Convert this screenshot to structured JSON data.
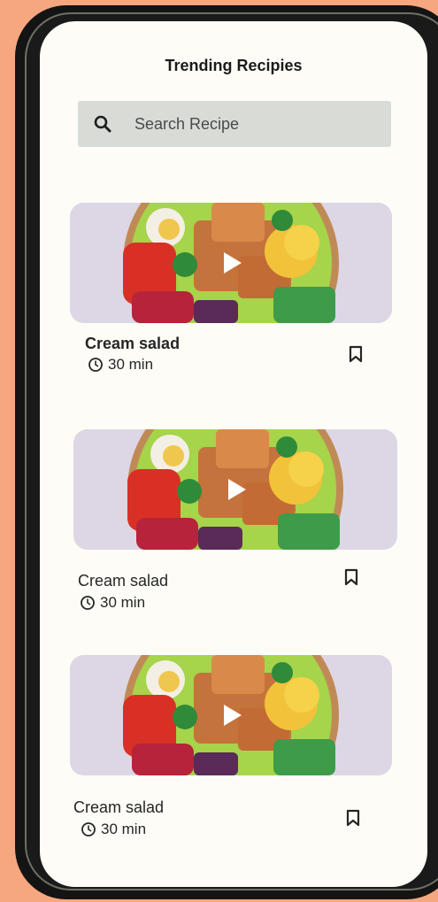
{
  "header": {
    "title": "Trending Recipies"
  },
  "search": {
    "placeholder": "Search Recipe"
  },
  "recipes": [
    {
      "name": "Cream salad",
      "time": "30 min"
    },
    {
      "name": "Cream salad",
      "time": "30 min"
    },
    {
      "name": "Cream salad",
      "time": "30 min"
    }
  ],
  "icons": {
    "search": "search-icon",
    "clock": "clock-icon",
    "bookmark": "bookmark-icon",
    "play": "play-icon"
  },
  "colors": {
    "background": "#f7a77f",
    "screen": "#fdfcf6",
    "search_bg": "#d9dcd6"
  }
}
